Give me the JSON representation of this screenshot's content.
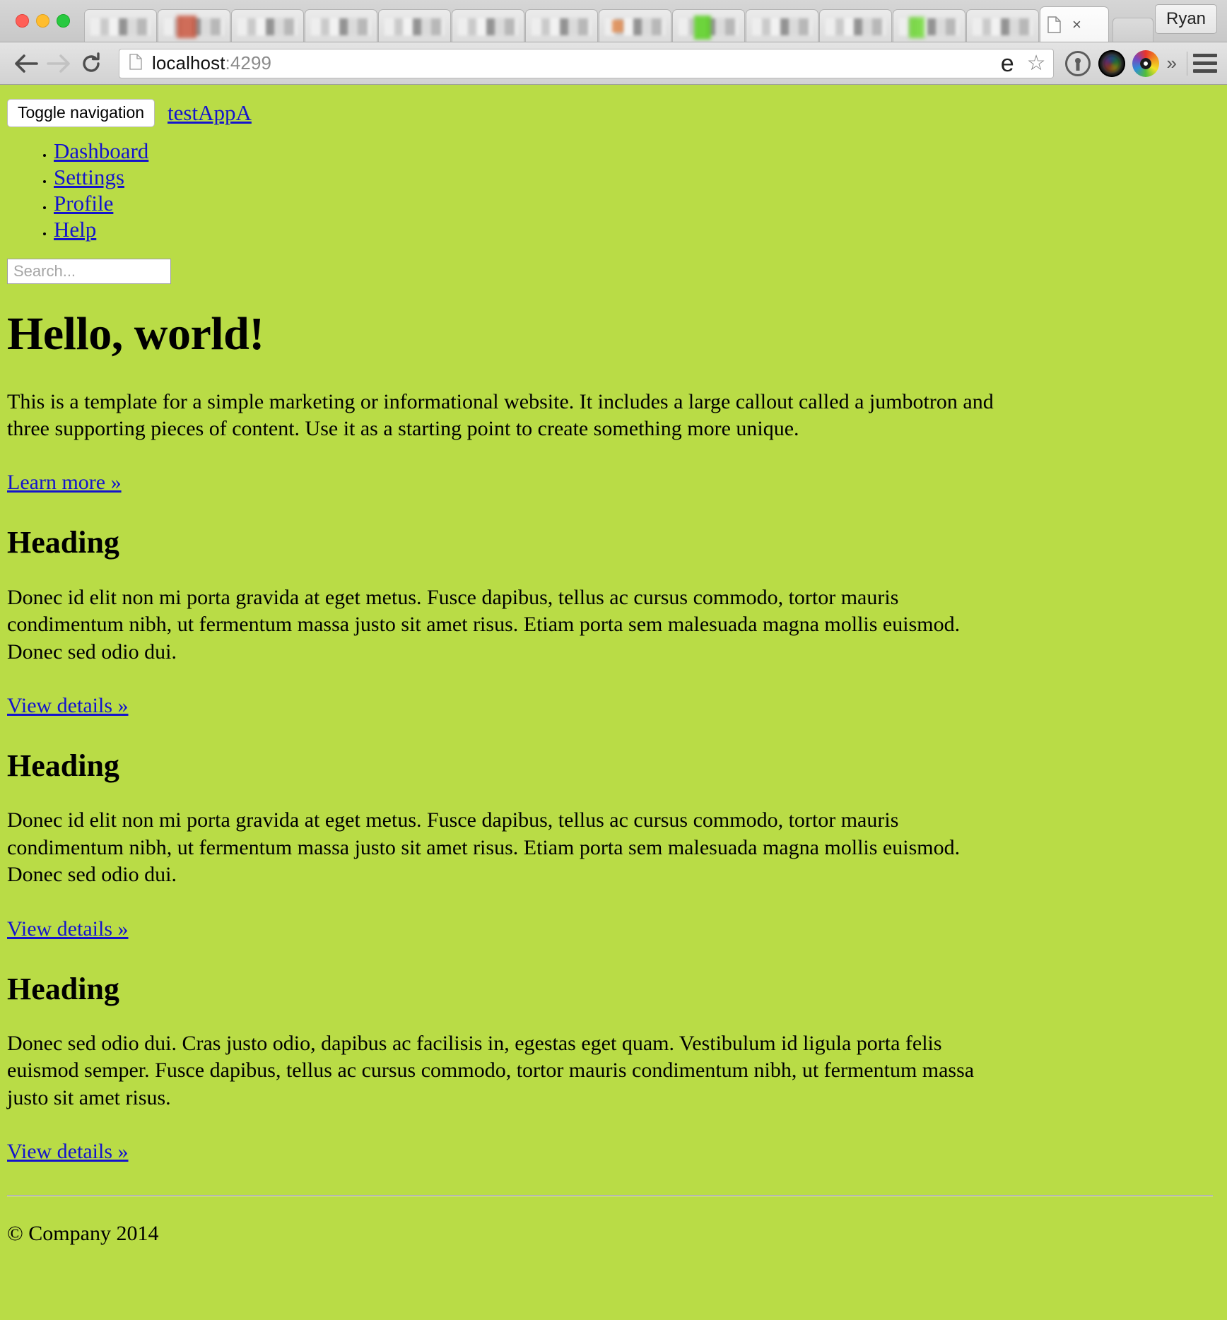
{
  "browser": {
    "window_controls": [
      "close",
      "minimize",
      "maximize"
    ],
    "profile_label": "Ryan",
    "active_tab": {
      "icon": "page-icon",
      "close_label": "×"
    },
    "background_tabs_count": 12,
    "toolbar": {
      "back_icon": "back-arrow-icon",
      "forward_icon": "forward-arrow-icon",
      "reload_icon": "reload-icon",
      "url_host": "localhost",
      "url_port": ":4299",
      "url_full": "localhost:4299",
      "page_action_e": "e",
      "bookmark_icon": "☆",
      "extensions": [
        "1password-icon",
        "camera-lens-icon",
        "color-ring-icon"
      ],
      "overflow_label": "»",
      "menu_icon": "hamburger-menu-icon"
    }
  },
  "page": {
    "background_color": "#b9dc46",
    "link_color": "#1414cc",
    "navbar": {
      "toggle_label": "Toggle navigation",
      "brand": "testAppA",
      "items": [
        {
          "label": "Dashboard"
        },
        {
          "label": "Settings"
        },
        {
          "label": "Profile"
        },
        {
          "label": "Help"
        }
      ],
      "search_placeholder": "Search...",
      "search_value": ""
    },
    "jumbotron": {
      "title": "Hello, world!",
      "text": "This is a template for a simple marketing or informational website. It includes a large callout called a jumbotron and three supporting pieces of content. Use it as a starting point to create something more unique.",
      "cta_label": "Learn more »"
    },
    "sections": [
      {
        "heading": "Heading",
        "text": "Donec id elit non mi porta gravida at eget metus. Fusce dapibus, tellus ac cursus commodo, tortor mauris condimentum nibh, ut fermentum massa justo sit amet risus. Etiam porta sem malesuada magna mollis euismod. Donec sed odio dui.",
        "link_label": "View details »"
      },
      {
        "heading": "Heading",
        "text": "Donec id elit non mi porta gravida at eget metus. Fusce dapibus, tellus ac cursus commodo, tortor mauris condimentum nibh, ut fermentum massa justo sit amet risus. Etiam porta sem malesuada magna mollis euismod. Donec sed odio dui.",
        "link_label": "View details »"
      },
      {
        "heading": "Heading",
        "text": "Donec sed odio dui. Cras justo odio, dapibus ac facilisis in, egestas eget quam. Vestibulum id ligula porta felis euismod semper. Fusce dapibus, tellus ac cursus commodo, tortor mauris condimentum nibh, ut fermentum massa justo sit amet risus.",
        "link_label": "View details »"
      }
    ],
    "footer": {
      "copyright": "© Company 2014"
    }
  }
}
